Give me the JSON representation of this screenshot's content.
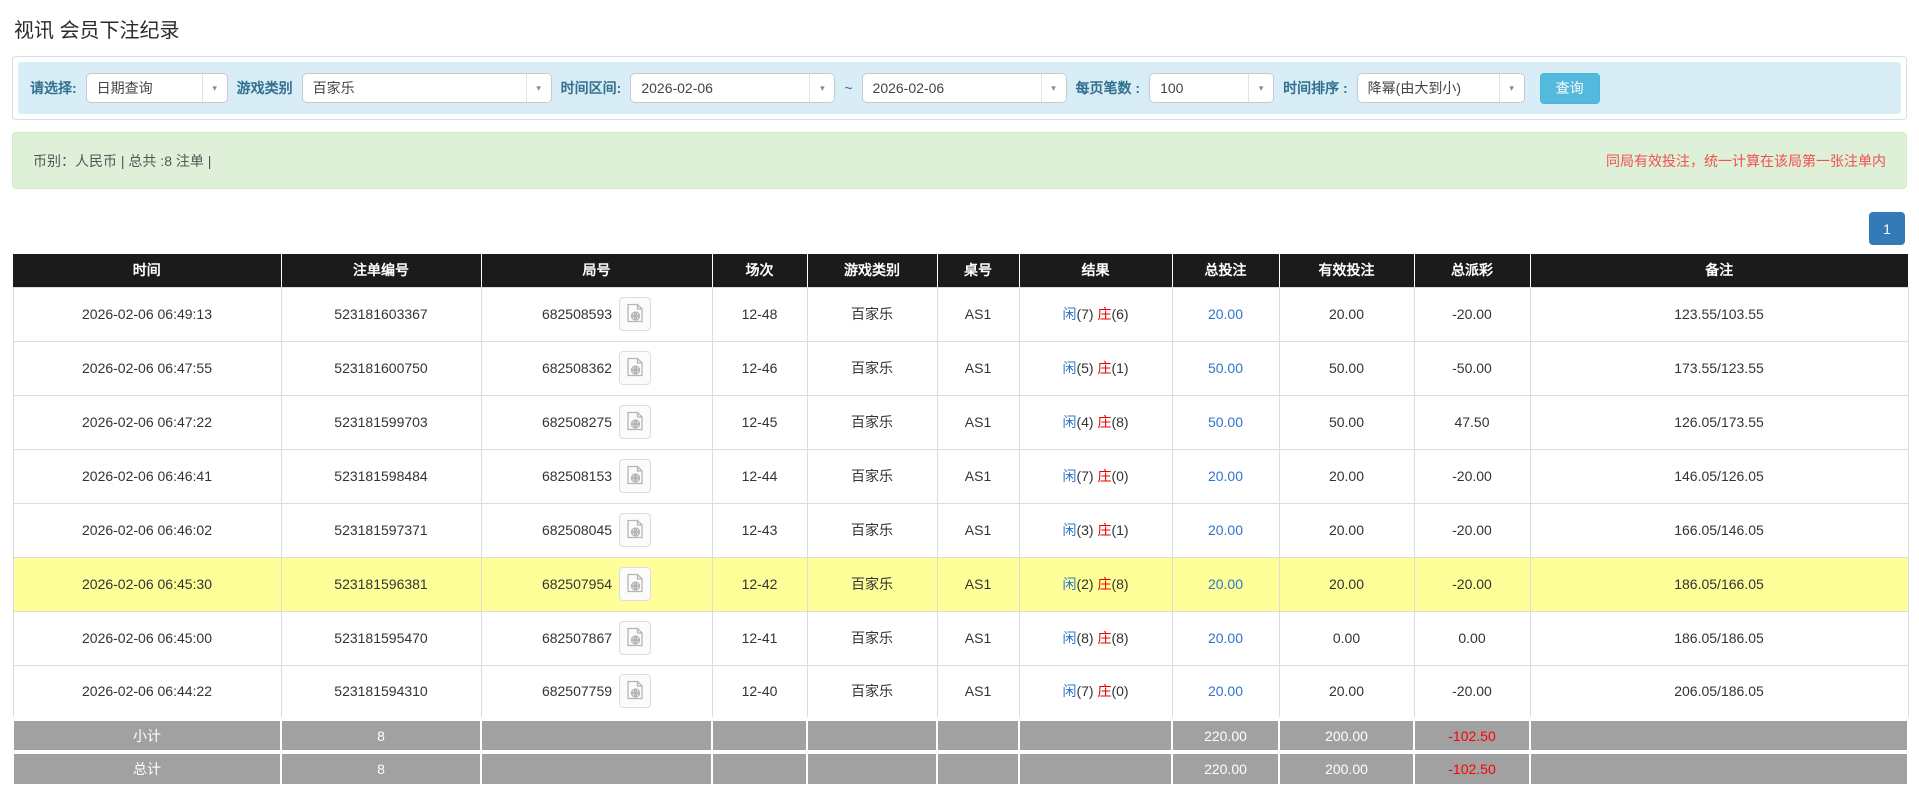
{
  "page": {
    "title": "视讯 会员下注纪录"
  },
  "filters": {
    "select_label": "请选择:",
    "select_value": "日期查询",
    "game_type_label": "游戏类别",
    "game_type_value": "百家乐",
    "time_range_label": "时间区间:",
    "time_from": "2026-02-06",
    "time_separator": "~",
    "time_to": "2026-02-06",
    "page_size_label": "每页笔数 :",
    "page_size_value": "100",
    "sort_label": "时间排序 :",
    "sort_value": "降幂(由大到小)",
    "search_button": "查询"
  },
  "summary": {
    "left_text": "币别：人民币 | 总共 :8 注单 |",
    "right_note": "同局有效投注，统一计算在该局第一张注单内"
  },
  "pagination": {
    "current_page": "1"
  },
  "icons": {
    "dropdown_arrow": "▾",
    "video_icon": "video-replay-icon"
  },
  "colors": {
    "filter_bar_bg": "#d9edf7",
    "filter_label": "#31708f",
    "search_button_bg": "#53b9dd",
    "summary_bg": "#dff0d8",
    "note_red": "#f05050",
    "header_bg": "#1b1b1b",
    "highlight_yellow": "#ffff99",
    "link_blue": "#2e74cc",
    "banker_red": "#e60000",
    "negative_red": "#ff0000",
    "footer_gray": "#a1a1a1",
    "page_btn_blue": "#337ab7"
  },
  "table": {
    "columns": [
      "时间",
      "注单编号",
      "局号",
      "场次",
      "游戏类别",
      "桌号",
      "结果",
      "总投注",
      "有效投注",
      "总派彩",
      "备注"
    ],
    "result_labels": {
      "player": "闲",
      "banker": "庄"
    },
    "rows": [
      {
        "time": "2026-02-06 06:49:13",
        "bet_id": "523181603367",
        "round_id": "682508593",
        "session": "12-48",
        "game": "百家乐",
        "table_no": "AS1",
        "player": "7",
        "banker": "6",
        "total_bet": "20.00",
        "valid_bet": "20.00",
        "payout": "-20.00",
        "remark": "123.55/103.55",
        "highlight": false
      },
      {
        "time": "2026-02-06 06:47:55",
        "bet_id": "523181600750",
        "round_id": "682508362",
        "session": "12-46",
        "game": "百家乐",
        "table_no": "AS1",
        "player": "5",
        "banker": "1",
        "total_bet": "50.00",
        "valid_bet": "50.00",
        "payout": "-50.00",
        "remark": "173.55/123.55",
        "highlight": false
      },
      {
        "time": "2026-02-06 06:47:22",
        "bet_id": "523181599703",
        "round_id": "682508275",
        "session": "12-45",
        "game": "百家乐",
        "table_no": "AS1",
        "player": "4",
        "banker": "8",
        "total_bet": "50.00",
        "valid_bet": "50.00",
        "payout": "47.50",
        "remark": "126.05/173.55",
        "highlight": false
      },
      {
        "time": "2026-02-06 06:46:41",
        "bet_id": "523181598484",
        "round_id": "682508153",
        "session": "12-44",
        "game": "百家乐",
        "table_no": "AS1",
        "player": "7",
        "banker": "0",
        "total_bet": "20.00",
        "valid_bet": "20.00",
        "payout": "-20.00",
        "remark": "146.05/126.05",
        "highlight": false
      },
      {
        "time": "2026-02-06 06:46:02",
        "bet_id": "523181597371",
        "round_id": "682508045",
        "session": "12-43",
        "game": "百家乐",
        "table_no": "AS1",
        "player": "3",
        "banker": "1",
        "total_bet": "20.00",
        "valid_bet": "20.00",
        "payout": "-20.00",
        "remark": "166.05/146.05",
        "highlight": false
      },
      {
        "time": "2026-02-06 06:45:30",
        "bet_id": "523181596381",
        "round_id": "682507954",
        "session": "12-42",
        "game": "百家乐",
        "table_no": "AS1",
        "player": "2",
        "banker": "8",
        "total_bet": "20.00",
        "valid_bet": "20.00",
        "payout": "-20.00",
        "remark": "186.05/166.05",
        "highlight": true
      },
      {
        "time": "2026-02-06 06:45:00",
        "bet_id": "523181595470",
        "round_id": "682507867",
        "session": "12-41",
        "game": "百家乐",
        "table_no": "AS1",
        "player": "8",
        "banker": "8",
        "total_bet": "20.00",
        "valid_bet": "0.00",
        "payout": "0.00",
        "remark": "186.05/186.05",
        "highlight": false
      },
      {
        "time": "2026-02-06 06:44:22",
        "bet_id": "523181594310",
        "round_id": "682507759",
        "session": "12-40",
        "game": "百家乐",
        "table_no": "AS1",
        "player": "7",
        "banker": "0",
        "total_bet": "20.00",
        "valid_bet": "20.00",
        "payout": "-20.00",
        "remark": "206.05/186.05",
        "highlight": false
      }
    ],
    "footer_rows": [
      {
        "label": "小计",
        "count": "8",
        "total_bet": "220.00",
        "valid_bet": "200.00",
        "payout": "-102.50"
      },
      {
        "label": "总计",
        "count": "8",
        "total_bet": "220.00",
        "valid_bet": "200.00",
        "payout": "-102.50"
      }
    ]
  }
}
